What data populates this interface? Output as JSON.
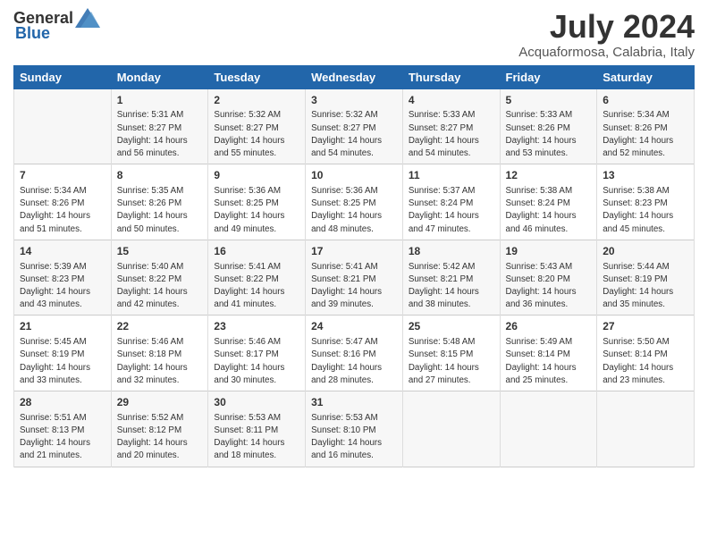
{
  "logo": {
    "general": "General",
    "blue": "Blue"
  },
  "title": "July 2024",
  "location": "Acquaformosa, Calabria, Italy",
  "headers": [
    "Sunday",
    "Monday",
    "Tuesday",
    "Wednesday",
    "Thursday",
    "Friday",
    "Saturday"
  ],
  "weeks": [
    [
      {
        "day": "",
        "info": ""
      },
      {
        "day": "1",
        "info": "Sunrise: 5:31 AM\nSunset: 8:27 PM\nDaylight: 14 hours\nand 56 minutes."
      },
      {
        "day": "2",
        "info": "Sunrise: 5:32 AM\nSunset: 8:27 PM\nDaylight: 14 hours\nand 55 minutes."
      },
      {
        "day": "3",
        "info": "Sunrise: 5:32 AM\nSunset: 8:27 PM\nDaylight: 14 hours\nand 54 minutes."
      },
      {
        "day": "4",
        "info": "Sunrise: 5:33 AM\nSunset: 8:27 PM\nDaylight: 14 hours\nand 54 minutes."
      },
      {
        "day": "5",
        "info": "Sunrise: 5:33 AM\nSunset: 8:26 PM\nDaylight: 14 hours\nand 53 minutes."
      },
      {
        "day": "6",
        "info": "Sunrise: 5:34 AM\nSunset: 8:26 PM\nDaylight: 14 hours\nand 52 minutes."
      }
    ],
    [
      {
        "day": "7",
        "info": "Sunrise: 5:34 AM\nSunset: 8:26 PM\nDaylight: 14 hours\nand 51 minutes."
      },
      {
        "day": "8",
        "info": "Sunrise: 5:35 AM\nSunset: 8:26 PM\nDaylight: 14 hours\nand 50 minutes."
      },
      {
        "day": "9",
        "info": "Sunrise: 5:36 AM\nSunset: 8:25 PM\nDaylight: 14 hours\nand 49 minutes."
      },
      {
        "day": "10",
        "info": "Sunrise: 5:36 AM\nSunset: 8:25 PM\nDaylight: 14 hours\nand 48 minutes."
      },
      {
        "day": "11",
        "info": "Sunrise: 5:37 AM\nSunset: 8:24 PM\nDaylight: 14 hours\nand 47 minutes."
      },
      {
        "day": "12",
        "info": "Sunrise: 5:38 AM\nSunset: 8:24 PM\nDaylight: 14 hours\nand 46 minutes."
      },
      {
        "day": "13",
        "info": "Sunrise: 5:38 AM\nSunset: 8:23 PM\nDaylight: 14 hours\nand 45 minutes."
      }
    ],
    [
      {
        "day": "14",
        "info": "Sunrise: 5:39 AM\nSunset: 8:23 PM\nDaylight: 14 hours\nand 43 minutes."
      },
      {
        "day": "15",
        "info": "Sunrise: 5:40 AM\nSunset: 8:22 PM\nDaylight: 14 hours\nand 42 minutes."
      },
      {
        "day": "16",
        "info": "Sunrise: 5:41 AM\nSunset: 8:22 PM\nDaylight: 14 hours\nand 41 minutes."
      },
      {
        "day": "17",
        "info": "Sunrise: 5:41 AM\nSunset: 8:21 PM\nDaylight: 14 hours\nand 39 minutes."
      },
      {
        "day": "18",
        "info": "Sunrise: 5:42 AM\nSunset: 8:21 PM\nDaylight: 14 hours\nand 38 minutes."
      },
      {
        "day": "19",
        "info": "Sunrise: 5:43 AM\nSunset: 8:20 PM\nDaylight: 14 hours\nand 36 minutes."
      },
      {
        "day": "20",
        "info": "Sunrise: 5:44 AM\nSunset: 8:19 PM\nDaylight: 14 hours\nand 35 minutes."
      }
    ],
    [
      {
        "day": "21",
        "info": "Sunrise: 5:45 AM\nSunset: 8:19 PM\nDaylight: 14 hours\nand 33 minutes."
      },
      {
        "day": "22",
        "info": "Sunrise: 5:46 AM\nSunset: 8:18 PM\nDaylight: 14 hours\nand 32 minutes."
      },
      {
        "day": "23",
        "info": "Sunrise: 5:46 AM\nSunset: 8:17 PM\nDaylight: 14 hours\nand 30 minutes."
      },
      {
        "day": "24",
        "info": "Sunrise: 5:47 AM\nSunset: 8:16 PM\nDaylight: 14 hours\nand 28 minutes."
      },
      {
        "day": "25",
        "info": "Sunrise: 5:48 AM\nSunset: 8:15 PM\nDaylight: 14 hours\nand 27 minutes."
      },
      {
        "day": "26",
        "info": "Sunrise: 5:49 AM\nSunset: 8:14 PM\nDaylight: 14 hours\nand 25 minutes."
      },
      {
        "day": "27",
        "info": "Sunrise: 5:50 AM\nSunset: 8:14 PM\nDaylight: 14 hours\nand 23 minutes."
      }
    ],
    [
      {
        "day": "28",
        "info": "Sunrise: 5:51 AM\nSunset: 8:13 PM\nDaylight: 14 hours\nand 21 minutes."
      },
      {
        "day": "29",
        "info": "Sunrise: 5:52 AM\nSunset: 8:12 PM\nDaylight: 14 hours\nand 20 minutes."
      },
      {
        "day": "30",
        "info": "Sunrise: 5:53 AM\nSunset: 8:11 PM\nDaylight: 14 hours\nand 18 minutes."
      },
      {
        "day": "31",
        "info": "Sunrise: 5:53 AM\nSunset: 8:10 PM\nDaylight: 14 hours\nand 16 minutes."
      },
      {
        "day": "",
        "info": ""
      },
      {
        "day": "",
        "info": ""
      },
      {
        "day": "",
        "info": ""
      }
    ]
  ]
}
